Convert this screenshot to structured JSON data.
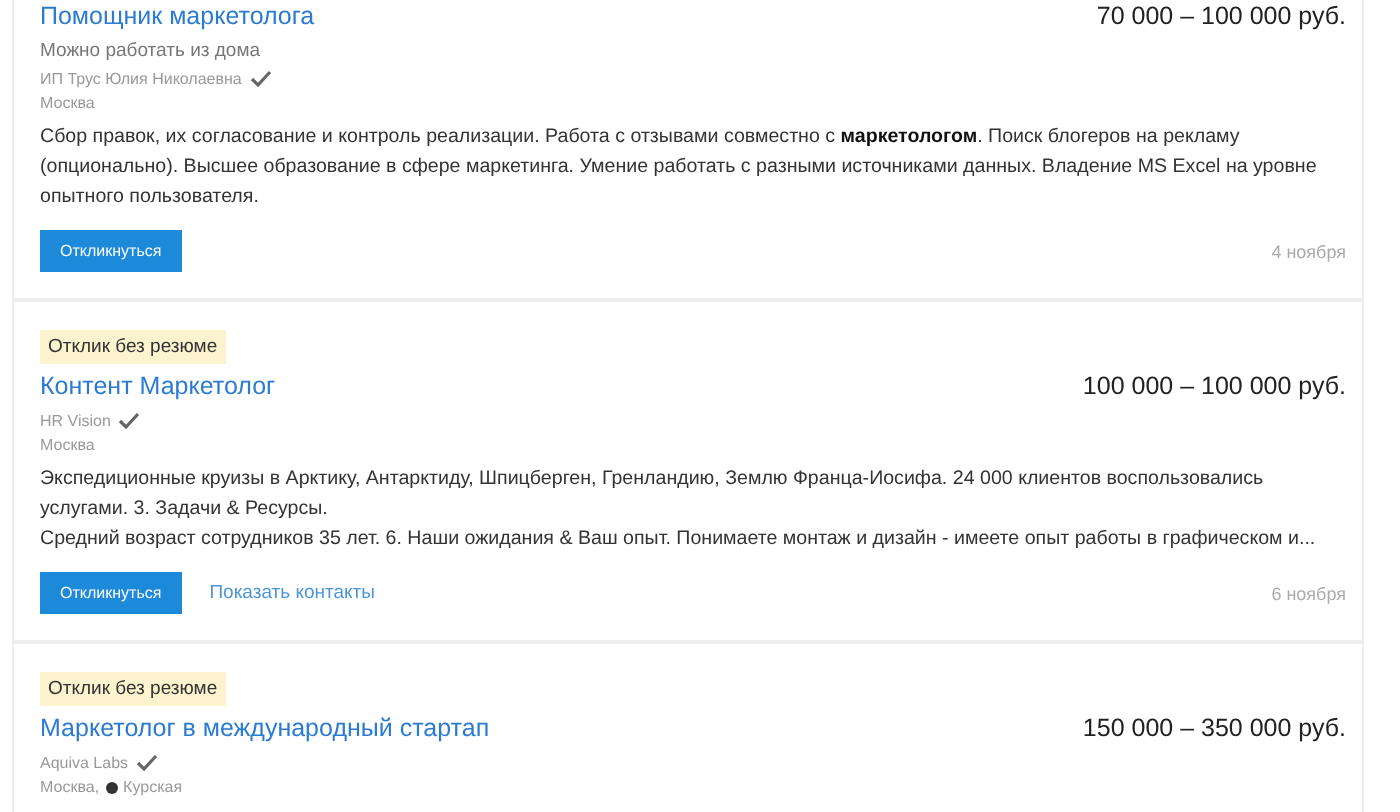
{
  "vacancies": [
    {
      "title": "Помощник маркетолога",
      "salary": "70 000 – 100 000 руб.",
      "subtitle": "Можно работать из дома",
      "company": "ИП Трус Юлия Николаевна",
      "verified": true,
      "city": "Москва",
      "description": [
        "Сбор правок, их согласование и контроль реализации. Работа с отзывами совместно с **маркетологом**. Поиск блогеров на рекламу (опционально). Высшее образование в сфере маркетинга. Умение работать с разными источниками данных. Владение MS Excel на уровне опытного пользователя."
      ],
      "buttons": [
        {
          "kind": "primary",
          "label": "Откликнуться"
        }
      ],
      "date": "4 ноября"
    },
    {
      "badge": "Отклик без резюме",
      "title": "Контент Маркетолог",
      "salary": "100 000 – 100 000 руб.",
      "company": "HR Vision",
      "verified": true,
      "city": "Москва",
      "description": [
        "Экспедиционные круизы в Арктику, Антарктиду, Шпицберген, Гренландию, Землю Франца-Иосифа. 24 000 клиентов воспользовались услугами. 3. Задачи & Ресурсы.",
        "Средний возраст сотрудников 35 лет. 6. Наши ожидания & Ваш опыт. Понимаете монтаж и дизайн - имеете опыт работы в графическом и..."
      ],
      "buttons": [
        {
          "kind": "primary",
          "label": "Откликнуться"
        },
        {
          "kind": "link",
          "label": "Показать контакты"
        }
      ],
      "date": "6 ноября"
    },
    {
      "badge": "Отклик без резюме",
      "title": "Маркетолог в международный стартап",
      "salary": "150 000 – 350 000 руб.",
      "company": "Aquiva Labs",
      "verified": true,
      "city": "Москва,",
      "metro": "Курская"
    }
  ]
}
